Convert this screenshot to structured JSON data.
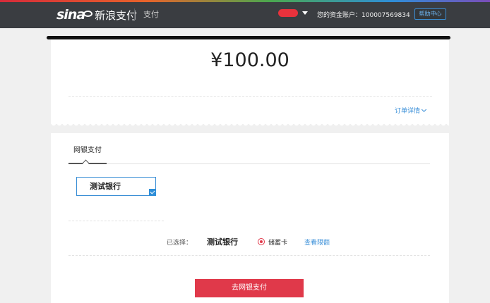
{
  "header": {
    "logo_text": "sina",
    "brand": "新浪支付",
    "section": "支付",
    "account_label": "您的资金账户：",
    "account_number": "100007569834",
    "help_label": "帮助中心"
  },
  "order": {
    "amount": "¥100.00",
    "details_link": "订单详情"
  },
  "payment": {
    "tab_label": "网银支付",
    "bank_option": "测试银行",
    "selected_label": "已选择：",
    "selected_bank": "测试银行",
    "card_type": "储蓄卡",
    "limit_link": "查看限额",
    "pay_button": "去网银支付"
  },
  "colors": {
    "header_bg": "#3a3d41",
    "accent_blue": "#3a8fd8",
    "pay_red": "#e0394a"
  }
}
